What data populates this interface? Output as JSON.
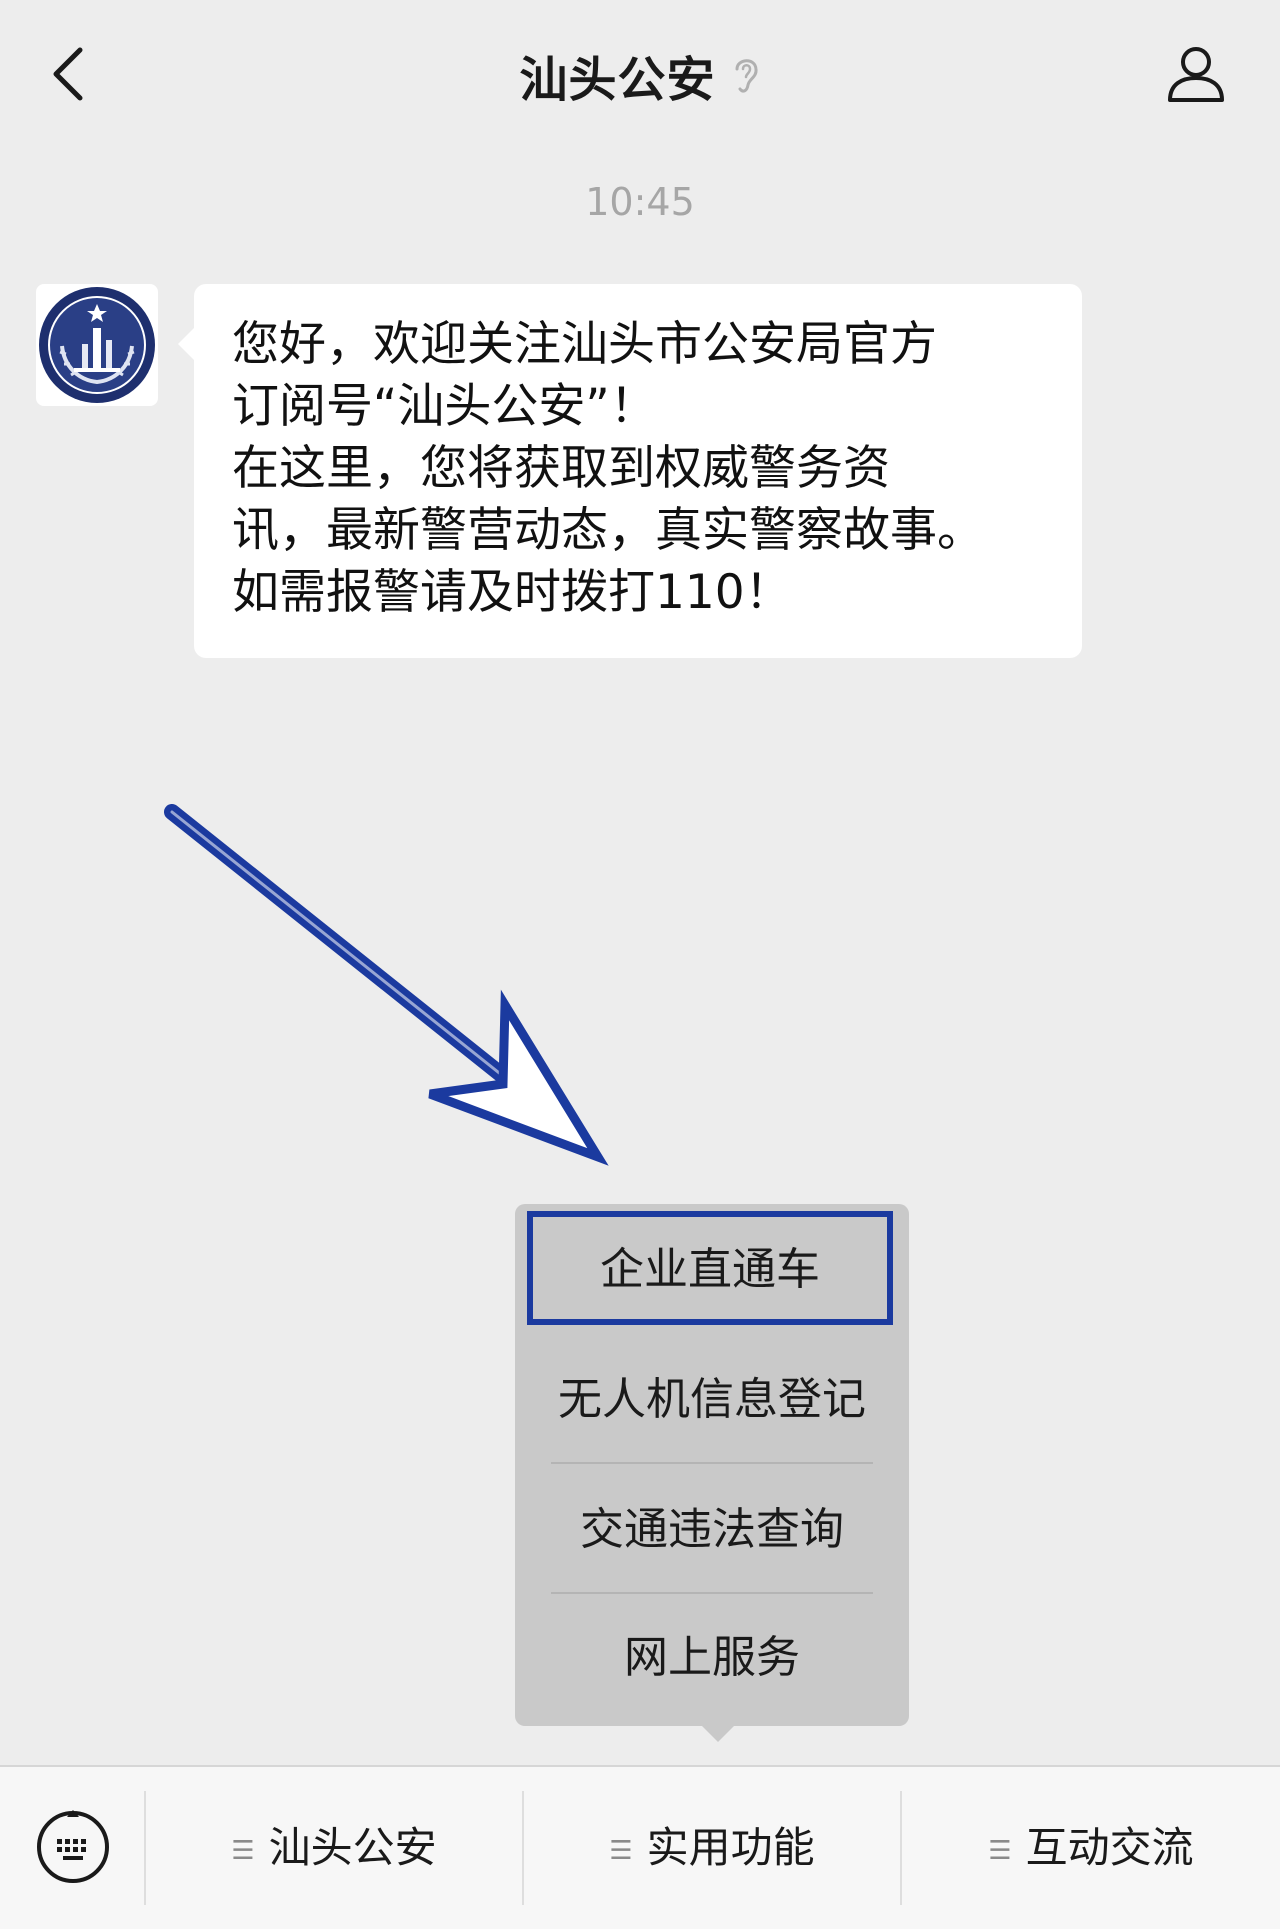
{
  "nav": {
    "title": "汕头公安",
    "back_icon": "chevron-left-icon",
    "ear_icon": "ear-icon",
    "profile_icon": "person-icon"
  },
  "chat": {
    "timestamp": "10:45",
    "message_lines": [
      "您好，欢迎关注汕头市公安局官方",
      "订阅号“汕头公安”！",
      "在这里，您将获取到权威警务资",
      "讯，最新警营动态，真实警察故事。",
      "如需报警请及时拨打110！"
    ]
  },
  "popup_menu": {
    "items": [
      "企业直通车",
      "无人机信息登记",
      "交通违法查询",
      "网上服务"
    ],
    "highlighted_index": 0
  },
  "bottom_bar": {
    "keyboard_icon": "keyboard-icon",
    "tabs": [
      "汕头公安",
      "实用功能",
      "互动交流"
    ]
  },
  "colors": {
    "background": "#ededed",
    "bubble": "#ffffff",
    "menu": "#c9c9c9",
    "annotation_blue": "#1b3a9f"
  }
}
